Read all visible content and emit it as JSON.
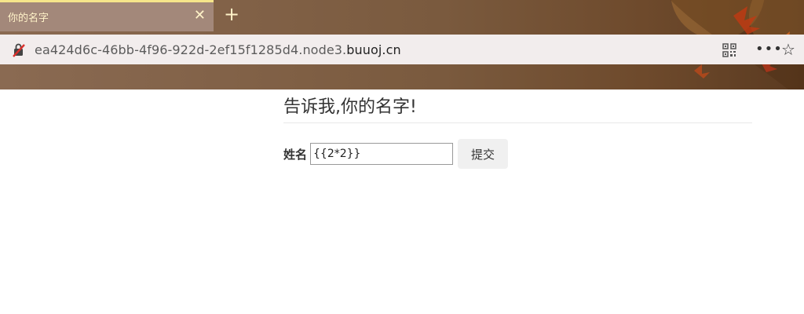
{
  "browser": {
    "tab": {
      "title": "你的名字",
      "close_label": "✕"
    },
    "new_tab_label": "+",
    "address": {
      "url_prefix": "ea424d6c-46bb-4f96-922d-2ef15f1285d4.node3.",
      "url_host": "buuoj.cn"
    },
    "icons": [
      "insecure-icon",
      "qr-code-icon",
      "more-options-icon",
      "favorite-star-icon"
    ],
    "more_label": "•••",
    "star_label": "☆"
  },
  "page": {
    "heading": "告诉我,你的名字!",
    "form": {
      "name_label": "姓名",
      "name_value": "{{2*2}}",
      "submit_label": "提交"
    }
  },
  "colors": {
    "chrome": "#7a5a3e",
    "tab_active": "#a3887a",
    "tab_accent": "#f6e58a",
    "address_bar": "#f2eded"
  }
}
